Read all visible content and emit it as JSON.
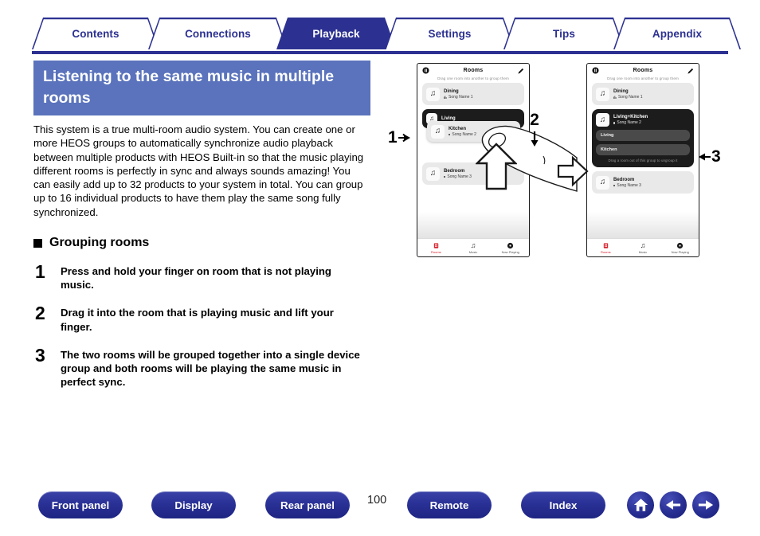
{
  "tabs": [
    {
      "label": "Contents",
      "active": false
    },
    {
      "label": "Connections",
      "active": false
    },
    {
      "label": "Playback",
      "active": true
    },
    {
      "label": "Settings",
      "active": false
    },
    {
      "label": "Tips",
      "active": false
    },
    {
      "label": "Appendix",
      "active": false
    }
  ],
  "page": {
    "heading": "Listening to the same music in multiple rooms",
    "intro": "This system is a true multi-room audio system. You can create one or more HEOS groups to automatically synchronize audio playback between multiple products with HEOS Built-in so that the music playing different rooms is perfectly in sync and always sounds amazing! You can easily add up to 32 products to your system in total. You can group up to 16 individual products to have them play the same song fully synchronized.",
    "section_title": "Grouping rooms",
    "steps": [
      {
        "num": "1",
        "text": "Press and hold your finger on room that is not playing music."
      },
      {
        "num": "2",
        "text": "Drag it into the room that is playing music and lift your finger."
      },
      {
        "num": "3",
        "text": "The two rooms will be grouped together into a single device group and both rooms will be playing the same music in perfect sync."
      }
    ]
  },
  "phone1": {
    "title": "Rooms",
    "hint": "Drag one room into another to group them",
    "rooms": [
      {
        "name": "Dining",
        "song": "Song Name 1",
        "dark": false
      },
      {
        "name": "Living",
        "song": "",
        "dark": true
      },
      {
        "name": "Kitchen",
        "song": "Song Name 2",
        "dark": false
      },
      {
        "name": "Bedroom",
        "song": "Song Name 3",
        "dark": false
      }
    ],
    "nav": [
      {
        "label": "Rooms",
        "selected": true
      },
      {
        "label": "Music",
        "selected": false
      },
      {
        "label": "Now Playing",
        "selected": false
      }
    ]
  },
  "phone2": {
    "title": "Rooms",
    "hint": "Drag one room into another to group them",
    "top_room": {
      "name": "Dining",
      "song": "Song Name 1"
    },
    "group": {
      "name": "Living+Kitchen",
      "song": "Song Name 2",
      "members": [
        "Living",
        "Kitchen"
      ],
      "ungroup_hint": "Drag a room out of this group to ungroup it"
    },
    "bottom_room": {
      "name": "Bedroom",
      "song": "Song Name 3"
    },
    "nav": [
      {
        "label": "Rooms",
        "selected": true
      },
      {
        "label": "Music",
        "selected": false
      },
      {
        "label": "Now Playing",
        "selected": false
      }
    ]
  },
  "annotations": {
    "callout1": "1",
    "callout2": "2",
    "callout3": "3"
  },
  "footer": {
    "buttons": [
      "Front panel",
      "Display",
      "Rear panel",
      "Remote",
      "Index"
    ],
    "page_number": "100",
    "icons": [
      "home-icon",
      "back-arrow-icon",
      "forward-arrow-icon"
    ]
  },
  "colors": {
    "brand_blue": "#2c3191",
    "heading_band": "#5a73bc",
    "accent_red": "#d8202a"
  }
}
